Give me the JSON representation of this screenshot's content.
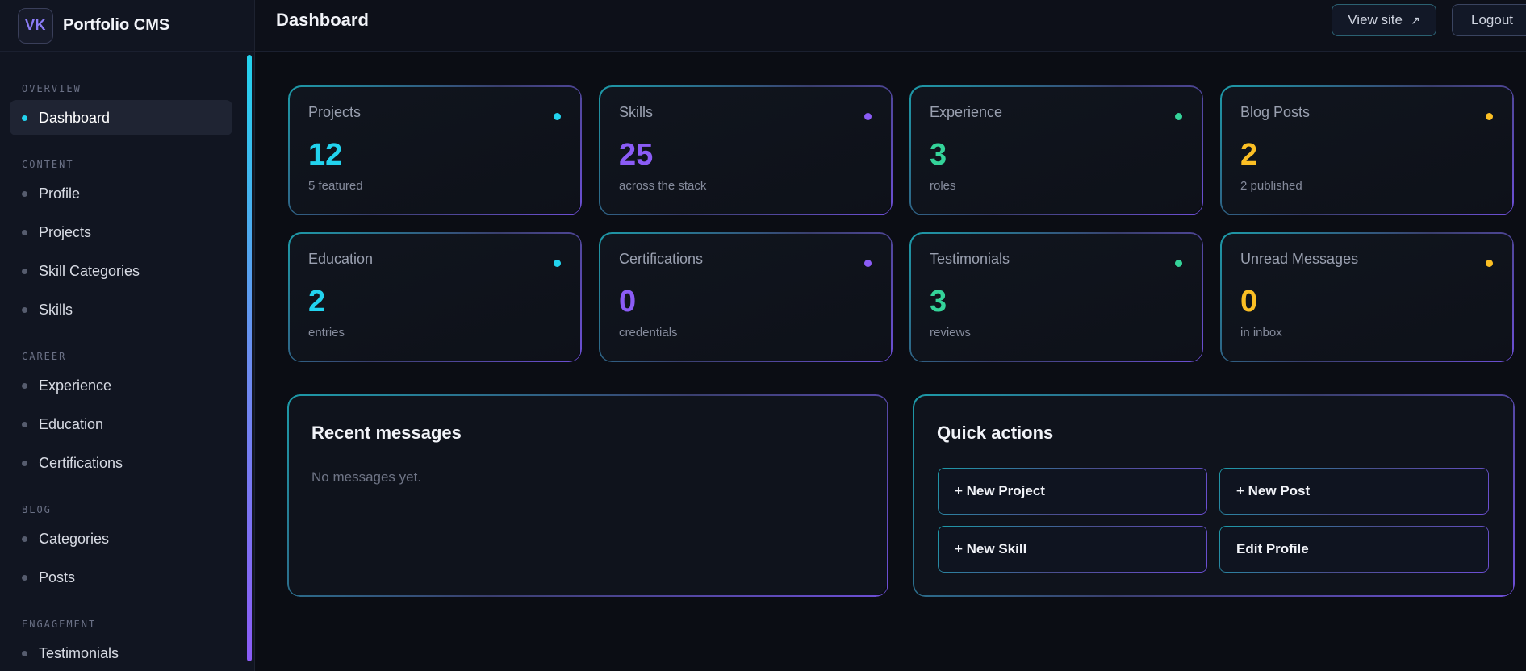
{
  "brand": {
    "initials": "VK",
    "name": "Portfolio CMS"
  },
  "header": {
    "title": "Dashboard",
    "view_site": "View site",
    "view_site_icon": "↗",
    "logout": "Logout"
  },
  "sidebar": {
    "sections": [
      {
        "title": "OVERVIEW",
        "items": [
          {
            "label": "Dashboard",
            "active": true
          }
        ]
      },
      {
        "title": "CONTENT",
        "items": [
          {
            "label": "Profile"
          },
          {
            "label": "Projects"
          },
          {
            "label": "Skill Categories"
          },
          {
            "label": "Skills"
          }
        ]
      },
      {
        "title": "CAREER",
        "items": [
          {
            "label": "Experience"
          },
          {
            "label": "Education"
          },
          {
            "label": "Certifications"
          }
        ]
      },
      {
        "title": "BLOG",
        "items": [
          {
            "label": "Categories"
          },
          {
            "label": "Posts"
          }
        ]
      },
      {
        "title": "ENGAGEMENT",
        "items": [
          {
            "label": "Testimonials"
          }
        ]
      }
    ]
  },
  "stats": [
    {
      "label": "Projects",
      "value": "12",
      "sub": "5 featured",
      "color": "#22d3ee"
    },
    {
      "label": "Skills",
      "value": "25",
      "sub": "across the stack",
      "color": "#8b5cf6"
    },
    {
      "label": "Experience",
      "value": "3",
      "sub": "roles",
      "color": "#34d399"
    },
    {
      "label": "Blog Posts",
      "value": "2",
      "sub": "2 published",
      "color": "#fbbf24"
    },
    {
      "label": "Education",
      "value": "2",
      "sub": "entries",
      "color": "#22d3ee"
    },
    {
      "label": "Certifications",
      "value": "0",
      "sub": "credentials",
      "color": "#8b5cf6"
    },
    {
      "label": "Testimonials",
      "value": "3",
      "sub": "reviews",
      "color": "#34d399"
    },
    {
      "label": "Unread Messages",
      "value": "0",
      "sub": "in inbox",
      "color": "#fbbf24"
    }
  ],
  "recent_messages": {
    "title": "Recent messages",
    "empty": "No messages yet."
  },
  "quick_actions": {
    "title": "Quick actions",
    "buttons": [
      "+ New Project",
      "+ New Post",
      "+ New Skill",
      "Edit Profile"
    ]
  }
}
